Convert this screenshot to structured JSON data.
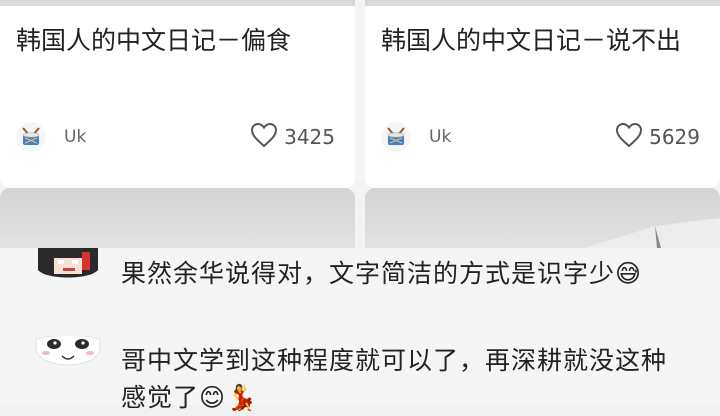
{
  "feed": {
    "cards": [
      {
        "title": "韩国人的中文日记－偏食",
        "author": "Uk",
        "likes": "3425",
        "author_icon": "drum-icon",
        "like_icon": "heart-outline-icon"
      },
      {
        "title": "韩国人的中文日记－说不出",
        "author": "Uk",
        "likes": "5629",
        "author_icon": "drum-icon",
        "like_icon": "heart-outline-icon"
      }
    ]
  },
  "comments": [
    {
      "text": "果然余华说得对，文字简洁的方式是识字少😅"
    },
    {
      "text": "哥中文学到这种程度就可以了，再深耕就没这种感觉了😊💃"
    }
  ],
  "colors": {
    "card_bg": "#ffffff",
    "page_bg": "#f4f4f4",
    "text": "#222222",
    "muted": "#666666"
  }
}
